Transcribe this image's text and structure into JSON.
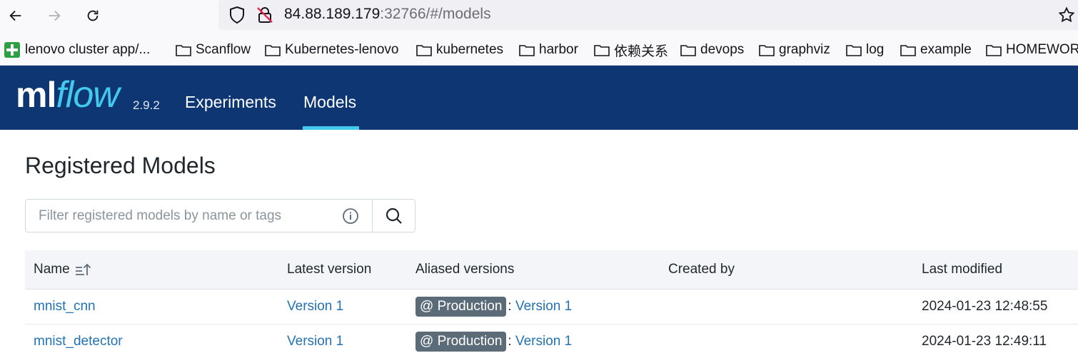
{
  "browser": {
    "url_host": "84.88.189.179",
    "url_rest": ":32766/#/models"
  },
  "bookmarks": [
    {
      "label": "lenovo cluster app/...",
      "icon": "green-plus-app-icon"
    },
    {
      "label": "Scanflow",
      "icon": "folder-icon"
    },
    {
      "label": "Kubernetes-lenovo",
      "icon": "folder-icon"
    },
    {
      "label": "kubernetes",
      "icon": "folder-icon"
    },
    {
      "label": "harbor",
      "icon": "folder-icon"
    },
    {
      "label": "依赖关系",
      "icon": "folder-icon"
    },
    {
      "label": "devops",
      "icon": "folder-icon"
    },
    {
      "label": "graphviz",
      "icon": "folder-icon"
    },
    {
      "label": "log",
      "icon": "folder-icon"
    },
    {
      "label": "example",
      "icon": "folder-icon"
    },
    {
      "label": "HOMEWOR",
      "icon": "folder-icon"
    }
  ],
  "header": {
    "logo_ml": "ml",
    "logo_flow": "flow",
    "version": "2.9.2",
    "nav": [
      "Experiments",
      "Models"
    ],
    "active_nav": "Models",
    "accent_color": "#43c9ed",
    "bg_color": "#0d3673"
  },
  "main": {
    "title": "Registered Models",
    "search_placeholder": "Filter registered models by name or tags"
  },
  "table": {
    "columns": [
      "Name",
      "Latest version",
      "Aliased versions",
      "Created by",
      "Last modified"
    ],
    "rows": [
      {
        "name": "mnist_cnn",
        "latest_version": "Version 1",
        "alias": "@ Production",
        "alias_version": "Version 1",
        "created_by": "",
        "last_modified": "2024-01-23 12:48:55"
      },
      {
        "name": "mnist_detector",
        "latest_version": "Version 1",
        "alias": "@ Production",
        "alias_version": "Version 1",
        "created_by": "",
        "last_modified": "2024-01-23 12:49:11"
      }
    ]
  }
}
